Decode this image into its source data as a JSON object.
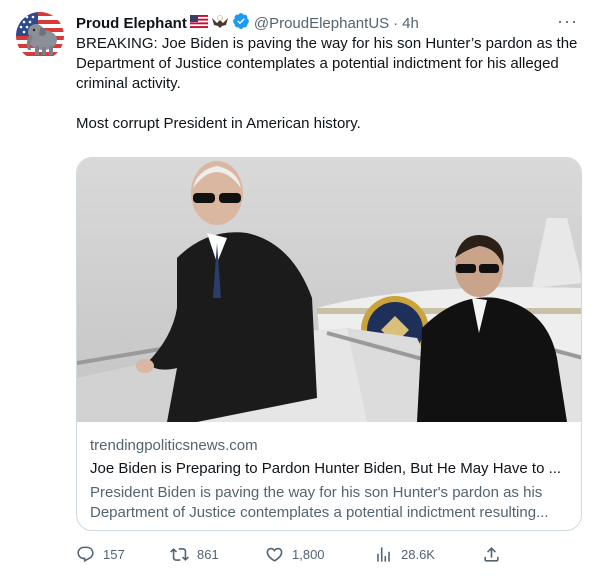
{
  "tweet": {
    "display_name": "Proud Elephant",
    "name_emojis": [
      "us-flag-icon",
      "eagle-icon"
    ],
    "handle": "@ProudElephantUS",
    "separator": "·",
    "time": "4h",
    "more_label": "···",
    "body": [
      "BREAKING: Joe Biden is paving the way for his son Hunter’s pardon as the Department of Justice contemplates a potential indictment for his alleged criminal activity.",
      "Most corrupt President in American history."
    ],
    "card": {
      "domain": "trendingpoliticsnews.com",
      "title": "Joe Biden is Preparing to Pardon Hunter Biden, But He May Have to ...",
      "description": "President Biden is paving the way for his son Hunter's pardon as his Department of Justice contemplates a potential indictment resulting..."
    },
    "actions": {
      "replies": "157",
      "retweets": "861",
      "likes": "1,800",
      "views": "28.6K"
    }
  },
  "colors": {
    "text": "#0f1419",
    "secondary": "#536471",
    "verified": "#1d9bf0",
    "border": "#cfd9de"
  }
}
